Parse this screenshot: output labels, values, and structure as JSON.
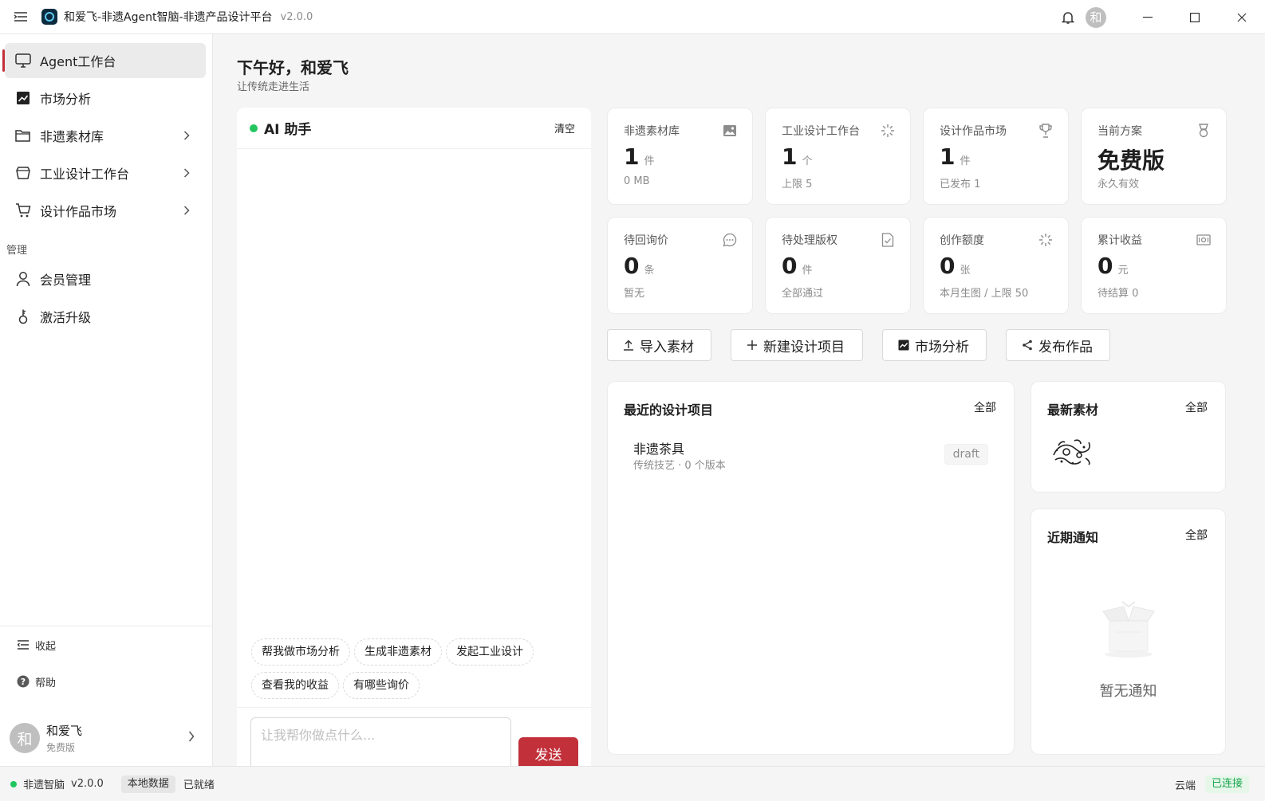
{
  "window": {
    "title": "和爱飞-非遗Agent智脑-非遗产品设计平台",
    "version": "v2.0.0",
    "avatar_char": "和"
  },
  "sidebar": {
    "items": [
      {
        "label": "Agent工作台",
        "icon": "monitor-icon"
      },
      {
        "label": "市场分析",
        "icon": "chart-icon"
      },
      {
        "label": "非遗素材库",
        "icon": "folder-icon"
      },
      {
        "label": "工业设计工作台",
        "icon": "cube-icon"
      },
      {
        "label": "设计作品市场",
        "icon": "cart-icon"
      }
    ],
    "section_manage": "管理",
    "manage_items": [
      {
        "label": "会员管理",
        "icon": "user-icon"
      },
      {
        "label": "激活升级",
        "icon": "key-icon"
      }
    ],
    "collapse_label": "收起",
    "help_label": "帮助",
    "user": {
      "avatar_char": "和",
      "name": "和爱飞",
      "plan": "免费版"
    }
  },
  "header": {
    "greeting": "下午好，和爱飞",
    "subtitle": "让传统走进生活"
  },
  "chat": {
    "title": "AI 助手",
    "clear_label": "清空",
    "chips": [
      "帮我做市场分析",
      "生成非遗素材",
      "发起工业设计",
      "查看我的收益",
      "有哪些询价"
    ],
    "input_placeholder": "让我帮你做点什么...",
    "send_label": "发送"
  },
  "stats": [
    {
      "label": "非遗素材库",
      "value": "1",
      "unit": "件",
      "sub": "0 MB",
      "icon": "image-icon"
    },
    {
      "label": "工业设计工作台",
      "value": "1",
      "unit": "个",
      "sub": "上限 5",
      "icon": "sparkle-icon"
    },
    {
      "label": "设计作品市场",
      "value": "1",
      "unit": "件",
      "sub": "已发布 1",
      "icon": "trophy-icon"
    },
    {
      "label": "当前方案",
      "value": "免费版",
      "unit": "",
      "sub": "永久有效",
      "icon": "medal-icon"
    },
    {
      "label": "待回询价",
      "value": "0",
      "unit": "条",
      "sub": "暂无",
      "icon": "message-icon"
    },
    {
      "label": "待处理版权",
      "value": "0",
      "unit": "件",
      "sub": "全部通过",
      "icon": "doc-check-icon"
    },
    {
      "label": "创作额度",
      "value": "0",
      "unit": "张",
      "sub": "本月生图 / 上限 50",
      "icon": "sparkle-icon"
    },
    {
      "label": "累计收益",
      "value": "0",
      "unit": "元",
      "sub": "待结算 0",
      "icon": "money-icon"
    }
  ],
  "actions": [
    {
      "label": "导入素材",
      "icon": "upload-icon"
    },
    {
      "label": "新建设计项目",
      "icon": "plus-icon"
    },
    {
      "label": "市场分析",
      "icon": "chart-icon"
    },
    {
      "label": "发布作品",
      "icon": "share-icon"
    }
  ],
  "recent_projects": {
    "title": "最近的设计项目",
    "all_label": "全部",
    "items": [
      {
        "name": "非遗茶具",
        "meta": "传统技艺 · 0 个版本",
        "status": "draft"
      }
    ]
  },
  "latest_assets": {
    "title": "最新素材",
    "all_label": "全部"
  },
  "notices": {
    "title": "近期通知",
    "all_label": "全部",
    "empty": "暂无通知"
  },
  "statusbar": {
    "app": "非遗智脑",
    "version": "v2.0.0",
    "data_tag": "本地数据",
    "ready": "已就绪",
    "cloud_label": "云端",
    "cloud_status": "已连接"
  },
  "colors": {
    "accent": "#c2303a",
    "online": "#22c55e"
  }
}
